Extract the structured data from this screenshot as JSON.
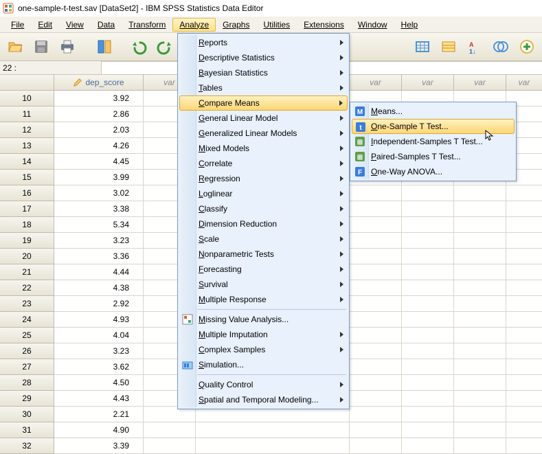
{
  "titlebar": "one-sample-t-test.sav [DataSet2] - IBM SPSS Statistics Data Editor",
  "menus": {
    "file": "File",
    "edit": "Edit",
    "view": "View",
    "data": "Data",
    "transform": "Transform",
    "analyze": "Analyze",
    "graphs": "Graphs",
    "utilities": "Utilities",
    "extensions": "Extensions",
    "window": "Window",
    "help": "Help"
  },
  "input_cell_label": "22 :",
  "columns": {
    "var1": "dep_score",
    "generic": "var"
  },
  "rows": [
    {
      "n": "10",
      "val": "3.92"
    },
    {
      "n": "11",
      "val": "2.86"
    },
    {
      "n": "12",
      "val": "2.03"
    },
    {
      "n": "13",
      "val": "4.26"
    },
    {
      "n": "14",
      "val": "4.45"
    },
    {
      "n": "15",
      "val": "3.99"
    },
    {
      "n": "16",
      "val": "3.02"
    },
    {
      "n": "17",
      "val": "3.38"
    },
    {
      "n": "18",
      "val": "5.34"
    },
    {
      "n": "19",
      "val": "3.23"
    },
    {
      "n": "20",
      "val": "3.36"
    },
    {
      "n": "21",
      "val": "4.44"
    },
    {
      "n": "22",
      "val": "4.38"
    },
    {
      "n": "23",
      "val": "2.92"
    },
    {
      "n": "24",
      "val": "4.93"
    },
    {
      "n": "25",
      "val": "4.04"
    },
    {
      "n": "26",
      "val": "3.23"
    },
    {
      "n": "27",
      "val": "3.62"
    },
    {
      "n": "28",
      "val": "4.50"
    },
    {
      "n": "29",
      "val": "4.43"
    },
    {
      "n": "30",
      "val": "2.21"
    },
    {
      "n": "31",
      "val": "4.90"
    },
    {
      "n": "32",
      "val": "3.39"
    }
  ],
  "analyze_menu": [
    {
      "label": "Reports",
      "arrow": true
    },
    {
      "label": "Descriptive Statistics",
      "arrow": true
    },
    {
      "label": "Bayesian Statistics",
      "arrow": true
    },
    {
      "label": "Tables",
      "arrow": true
    },
    {
      "label": "Compare Means",
      "arrow": true,
      "highlight": true
    },
    {
      "label": "General Linear Model",
      "arrow": true
    },
    {
      "label": "Generalized Linear Models",
      "arrow": true
    },
    {
      "label": "Mixed Models",
      "arrow": true
    },
    {
      "label": "Correlate",
      "arrow": true
    },
    {
      "label": "Regression",
      "arrow": true
    },
    {
      "label": "Loglinear",
      "arrow": true
    },
    {
      "label": "Classify",
      "arrow": true
    },
    {
      "label": "Dimension Reduction",
      "arrow": true
    },
    {
      "label": "Scale",
      "arrow": true
    },
    {
      "label": "Nonparametric Tests",
      "arrow": true
    },
    {
      "label": "Forecasting",
      "arrow": true
    },
    {
      "label": "Survival",
      "arrow": true
    },
    {
      "label": "Multiple Response",
      "arrow": true
    },
    {
      "label": "Missing Value Analysis...",
      "arrow": false,
      "icon": "mva"
    },
    {
      "label": "Multiple Imputation",
      "arrow": true
    },
    {
      "label": "Complex Samples",
      "arrow": true
    },
    {
      "label": "Simulation...",
      "arrow": false,
      "icon": "sim"
    },
    {
      "label": "Quality Control",
      "arrow": true
    },
    {
      "label": "Spatial and Temporal Modeling...",
      "arrow": true
    }
  ],
  "compare_means_menu": [
    {
      "label": "Means...",
      "icon": "M",
      "icon_bg": "#3b7dd8"
    },
    {
      "label": "One-Sample T Test...",
      "icon": "t",
      "icon_bg": "#3b7dd8",
      "highlight": true
    },
    {
      "label": "Independent-Samples T Test...",
      "icon": "⊞",
      "icon_bg": "#5f9e4a"
    },
    {
      "label": "Paired-Samples T Test...",
      "icon": "⊞",
      "icon_bg": "#5f9e4a"
    },
    {
      "label": "One-Way ANOVA...",
      "icon": "F",
      "icon_bg": "#3b7dd8"
    }
  ]
}
